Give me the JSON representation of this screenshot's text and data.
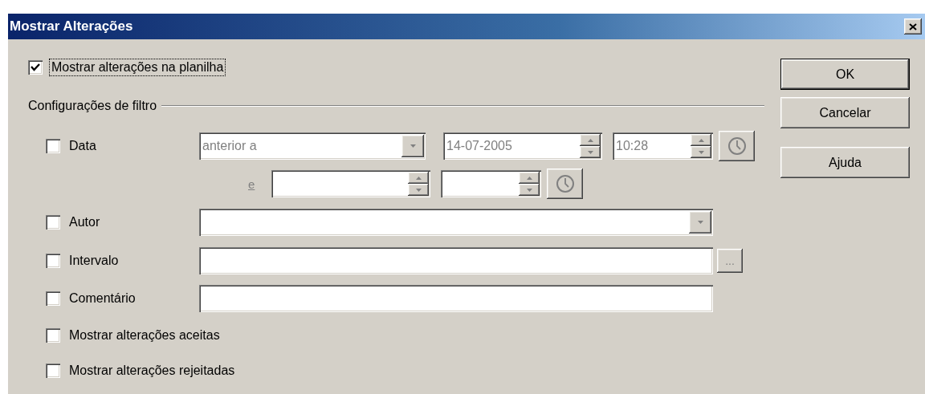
{
  "window": {
    "title": "Mostrar Alterações"
  },
  "show_changes": {
    "label": "Mostrar alterações na planilha",
    "checked": true,
    "focused": true
  },
  "filter": {
    "heading": "Configurações de filtro",
    "date": {
      "label": "Data",
      "checked": false,
      "disabled": true,
      "condition": "anterior a",
      "start_date": "14-07-2005",
      "start_time": "10:28",
      "and_label": "e"
    },
    "author": {
      "label": "Autor",
      "checked": false
    },
    "range": {
      "label": "Intervalo",
      "checked": false,
      "browse": "..."
    },
    "comment": {
      "label": "Comentário",
      "checked": false
    },
    "options": [
      {
        "label": "Mostrar alterações aceitas",
        "checked": false
      },
      {
        "label": "Mostrar alterações rejeitadas",
        "checked": false
      }
    ]
  },
  "buttons": [
    {
      "label": "OK",
      "default": true
    },
    {
      "label": "Cancelar",
      "default": false
    },
    {
      "label": "Ajuda",
      "default": false
    }
  ]
}
